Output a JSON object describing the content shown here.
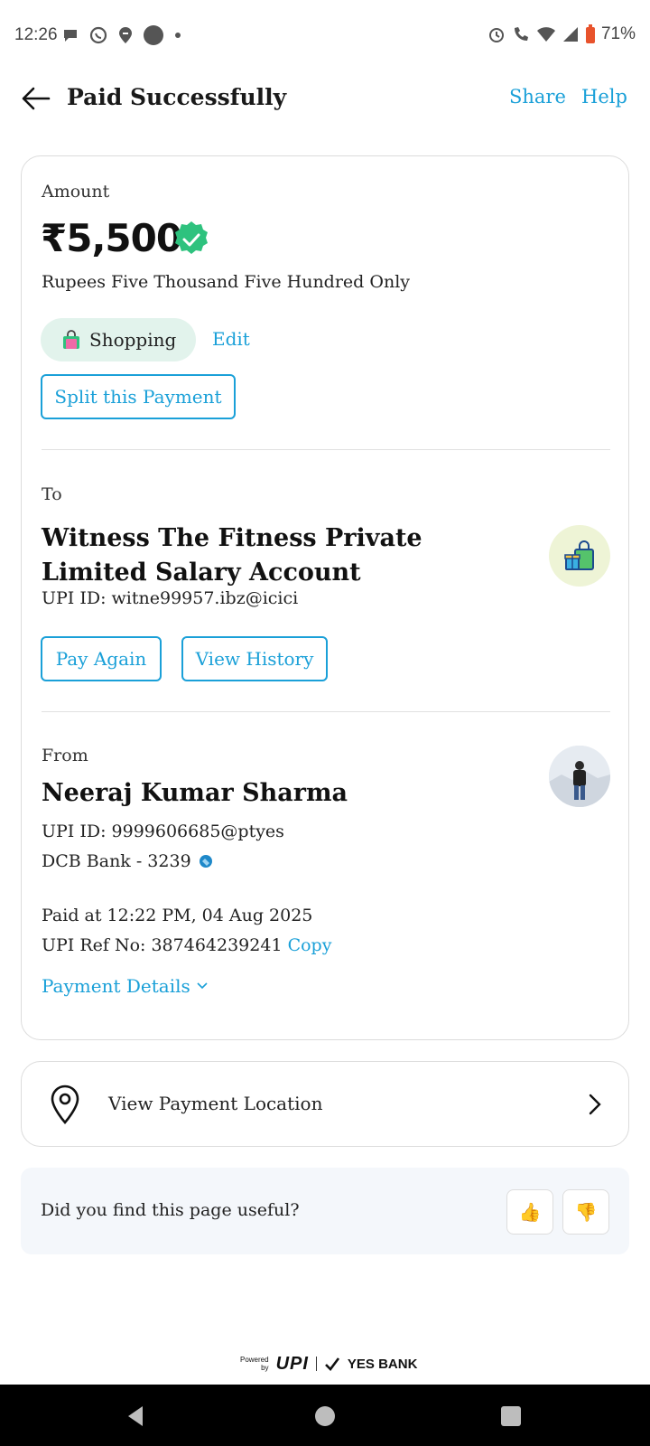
{
  "status_bar": {
    "time": "12:26",
    "battery": "71%",
    "left_icons": [
      "chat-icon",
      "whatsapp-icon",
      "swiggy-icon",
      "dot-icon",
      "small-dot-icon"
    ],
    "right_icons": [
      "alarm-icon",
      "wifi-call-icon",
      "wifi-icon",
      "signal-icon",
      "battery-icon"
    ]
  },
  "header": {
    "title": "Paid Successfully",
    "share_label": "Share",
    "help_label": "Help"
  },
  "payment": {
    "amount_label": "Amount",
    "amount": "₹5,500",
    "amount_words": "Rupees Five Thousand Five Hundred Only",
    "category": "Shopping",
    "category_edit": "Edit",
    "split_label": "Split this Payment"
  },
  "to": {
    "label": "To",
    "name": "Witness The Fitness Private Limited Salary Account",
    "upi_id": "UPI ID: witne99957.ibz@icici",
    "pay_again_label": "Pay Again",
    "view_history_label": "View History"
  },
  "from": {
    "label": "From",
    "name": "Neeraj Kumar Sharma",
    "upi_id": "UPI ID: 9999606685@ptyes",
    "bank": "DCB Bank - 3239",
    "paid_at": "Paid at 12:22 PM, 04 Aug 2025",
    "ref_no": "UPI Ref No: 387464239241",
    "copy_label": "Copy",
    "details_label": "Payment Details"
  },
  "location": {
    "label": "View Payment Location"
  },
  "feedback": {
    "question": "Did you find this page useful?",
    "thumbs_up": "👍",
    "thumbs_down": "👎"
  },
  "footer": {
    "powered_by": "Powered by",
    "upi": "UPI",
    "bank": "YES BANK"
  },
  "colors": {
    "accent": "#1aa0d8",
    "verified_green": "#2ec27e",
    "chip_bg": "#e2f3ec"
  }
}
